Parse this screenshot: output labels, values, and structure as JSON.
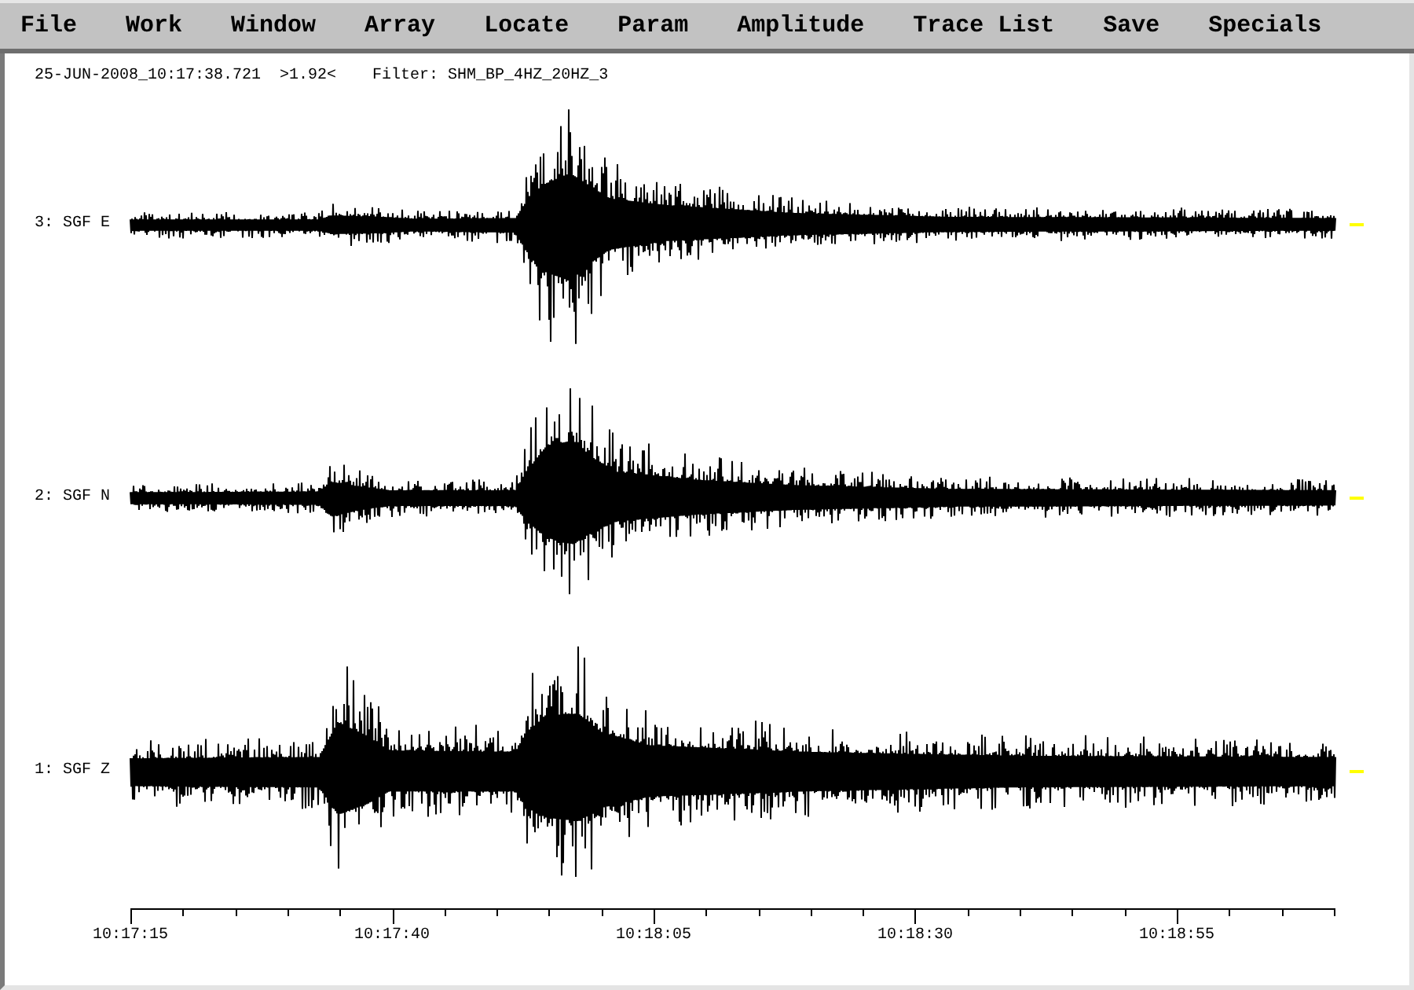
{
  "menu_bar": {
    "items": [
      "File",
      "Work",
      "Window",
      "Array",
      "Locate",
      "Param",
      "Amplitude",
      "Trace List",
      "Save",
      "Specials"
    ]
  },
  "header": {
    "time": "25-JUN-2008_10:17:38.721",
    "zoom": ">1.92<",
    "filter": "Filter: SHM_BP_4HZ_20HZ_3"
  },
  "traces": [
    {
      "label": "3: SGF E"
    },
    {
      "label": "2: SGF N"
    },
    {
      "label": "1: SGF Z"
    }
  ],
  "time_axis": {
    "labels": [
      "10:17:15",
      "10:17:40",
      "10:18:05",
      "10:18:30",
      "10:18:55"
    ]
  }
}
